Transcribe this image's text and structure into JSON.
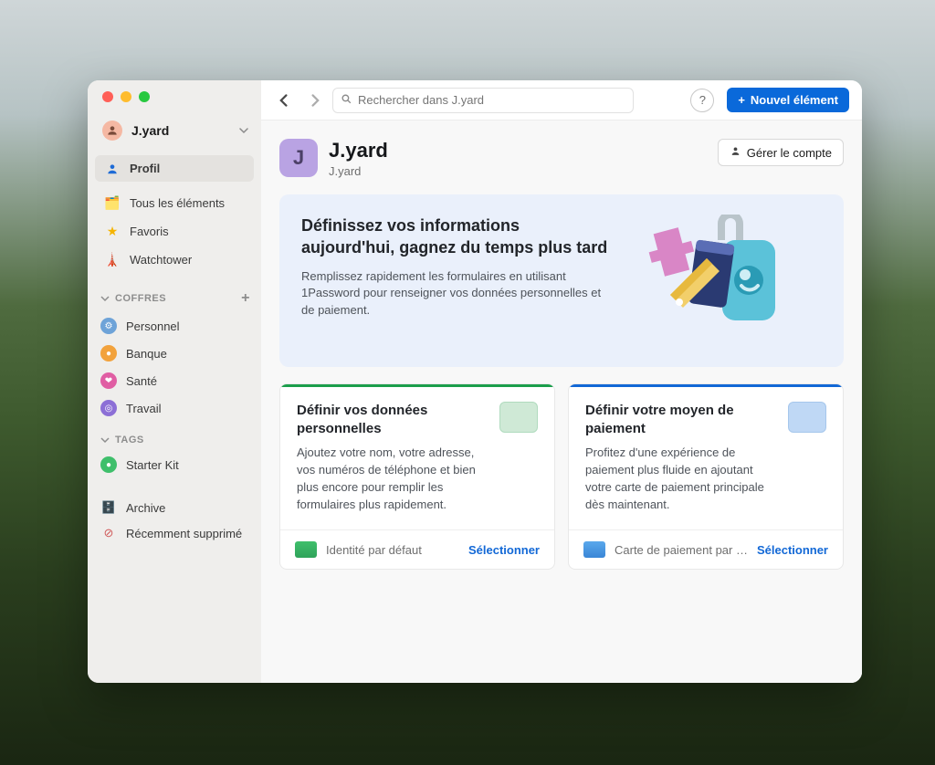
{
  "account": {
    "name": "J.yard",
    "initial": "J"
  },
  "sidebar": {
    "profile": "Profil",
    "all_items": "Tous les éléments",
    "favorites": "Favoris",
    "watchtower": "Watchtower",
    "vaults_header": "COFFRES",
    "vaults": [
      {
        "label": "Personnel"
      },
      {
        "label": "Banque"
      },
      {
        "label": "Santé"
      },
      {
        "label": "Travail"
      }
    ],
    "tags_header": "TAGS",
    "tags": [
      {
        "label": "Starter Kit"
      }
    ],
    "archive": "Archive",
    "recently_deleted": "Récemment supprimé"
  },
  "toolbar": {
    "search_placeholder": "Rechercher dans J.yard",
    "new_item_label": "Nouvel élément"
  },
  "header": {
    "title": "J.yard",
    "subtitle": "J.yard",
    "manage_label": "Gérer le compte"
  },
  "banner": {
    "title": "Définissez vos informations aujourd'hui, gagnez du temps plus tard",
    "body": "Remplissez rapidement les formulaires en utilisant 1Password pour renseigner vos données personnelles et de paiement."
  },
  "cards": {
    "personal": {
      "title": "Définir vos données personnelles",
      "body": "Ajoutez votre nom, votre adresse, vos numéros de téléphone et bien plus encore pour remplir les formulaires plus rapidement.",
      "footer_label": "Identité par défaut",
      "footer_action": "Sélectionner"
    },
    "payment": {
      "title": "Définir votre moyen de paiement",
      "body": "Profitez d'une expérience de paiement plus fluide en ajoutant votre carte de paiement principale dès maintenant.",
      "footer_label": "Carte de paiement par déf…",
      "footer_action": "Sélectionner"
    }
  }
}
